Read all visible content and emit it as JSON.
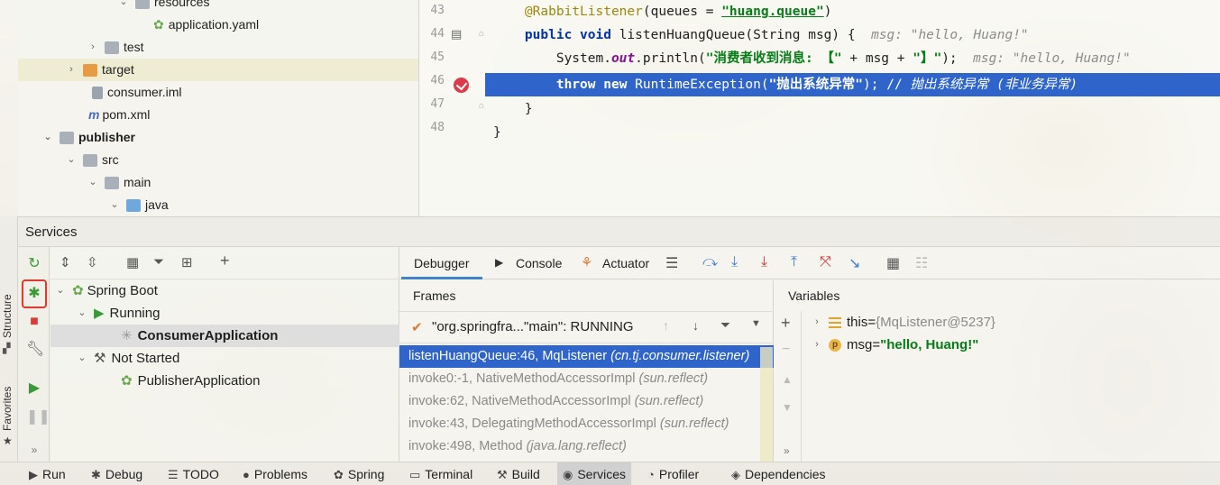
{
  "project_tree": [
    {
      "label": "resources",
      "icon": "folder-icon",
      "indent": 130,
      "chev": "v"
    },
    {
      "label": "application.yaml",
      "icon": "spring-config-icon",
      "indent": 155,
      "chev": ""
    },
    {
      "label": "test",
      "icon": "folder-icon",
      "indent": 80,
      "chev": ">"
    },
    {
      "label": "target",
      "icon": "folder-orange-icon",
      "indent": 55,
      "chev": ">"
    },
    {
      "label": "consumer.iml",
      "icon": "iml-file-icon",
      "indent": 80,
      "chev": ""
    },
    {
      "label": "pom.xml",
      "icon": "maven-icon",
      "indent": 80,
      "chev": ""
    },
    {
      "label": "publisher",
      "icon": "module-icon",
      "indent": 30,
      "chev": "v"
    },
    {
      "label": "src",
      "icon": "folder-icon",
      "indent": 55,
      "chev": "v"
    },
    {
      "label": "main",
      "icon": "folder-icon",
      "indent": 80,
      "chev": "v"
    },
    {
      "label": "java",
      "icon": "folder-blue-icon",
      "indent": 105,
      "chev": "v"
    }
  ],
  "editor": {
    "line_numbers": [
      "43",
      "44",
      "45",
      "46",
      "47",
      "48"
    ],
    "l43_annotation": "@RabbitListener",
    "l43_mid": "(queues = ",
    "l43_str": "\"huang.queue\"",
    "l43_end": ")",
    "l44_kw1": "public",
    "l44_kw2": "void",
    "l44_sig": " listenHuangQueue(String msg) {",
    "l44_hint": "msg: \"hello, Huang!\"",
    "l45_a": "System.",
    "l45_field": "out",
    "l45_b": ".println(",
    "l45_str1": "\"消费者收到消息: 【\"",
    "l45_c": " + msg + ",
    "l45_str2": "\"】\"",
    "l45_d": ");",
    "l45_hint": "msg: \"hello, Huang!\"",
    "l46_kw1": "throw",
    "l46_kw2": "new",
    "l46_a": " RuntimeException(",
    "l46_str": "\"抛出系统异常\"",
    "l46_b": "); // ",
    "l46_comment": "抛出系统异常 (非业务异常)",
    "l47": "}",
    "l48": "}"
  },
  "services": {
    "title": "Services",
    "tree": [
      {
        "label": "Spring Boot",
        "icon": "spring-boot-icon",
        "chev": "v"
      },
      {
        "label": "Running",
        "icon": "run-icon",
        "chev": "v"
      },
      {
        "label": "ConsumerApplication",
        "icon": "spinner-icon",
        "chev": ""
      },
      {
        "label": "Not Started",
        "icon": "wrench-icon",
        "chev": "v"
      },
      {
        "label": "PublisherApplication",
        "icon": "spring-config-icon",
        "chev": ""
      }
    ]
  },
  "debugger": {
    "tabs": [
      "Debugger",
      "Console",
      "Actuator"
    ],
    "frames_title": "Frames",
    "thread": "\"org.springfra...\"main\": RUNNING",
    "frames": [
      {
        "method": "listenHuangQueue:46, MqListener",
        "pkg": "(cn.tj.consumer.listener)"
      },
      {
        "method": "invoke0:-1, NativeMethodAccessorImpl",
        "pkg": "(sun.reflect)"
      },
      {
        "method": "invoke:62, NativeMethodAccessorImpl",
        "pkg": "(sun.reflect)"
      },
      {
        "method": "invoke:43, DelegatingMethodAccessorImpl",
        "pkg": "(sun.reflect)"
      },
      {
        "method": "invoke:498, Method",
        "pkg": "(java.lang.reflect)"
      }
    ],
    "variables_title": "Variables",
    "variables": [
      {
        "name": "this",
        "eq": " = ",
        "value": "{MqListener@5237}"
      },
      {
        "name": "msg",
        "eq": " = ",
        "value": "\"hello, Huang!\""
      }
    ]
  },
  "side_labels": {
    "structure": "Structure",
    "favorites": "Favorites"
  },
  "bottom_bar": [
    "Run",
    "Debug",
    "TODO",
    "Problems",
    "Spring",
    "Terminal",
    "Build",
    "Services",
    "Profiler",
    "Dependencies"
  ],
  "colors": {
    "selection": "#2f65ca",
    "breakpoint": "#db3b4b",
    "highlight_box": "#e03a2f"
  }
}
